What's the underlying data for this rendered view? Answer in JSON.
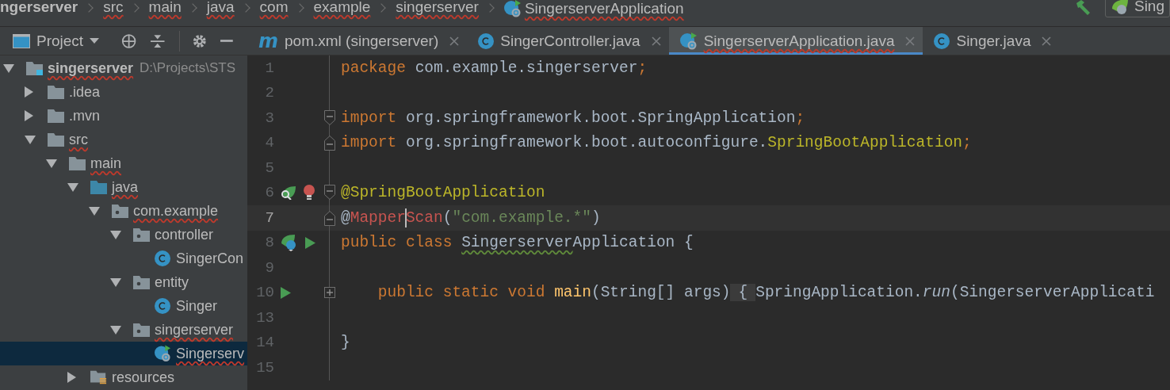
{
  "breadcrumbs": [
    {
      "label": "ngerserver",
      "kind": "project",
      "misspelled": false
    },
    {
      "label": "src",
      "kind": "folder",
      "misspelled": true
    },
    {
      "label": "main",
      "kind": "folder",
      "misspelled": true
    },
    {
      "label": "java",
      "kind": "folder",
      "misspelled": true
    },
    {
      "label": "com",
      "kind": "folder",
      "misspelled": true
    },
    {
      "label": "example",
      "kind": "folder",
      "misspelled": true
    },
    {
      "label": "singerserver",
      "kind": "folder",
      "misspelled": true
    },
    {
      "label": "SingerserverApplication",
      "kind": "app-class",
      "misspelled": true
    }
  ],
  "run_config": {
    "label": "Sing"
  },
  "tool_window": {
    "title": "Project"
  },
  "tabs": [
    {
      "label": "pom.xml (singerserver)",
      "kind": "maven",
      "badge": "m",
      "selected": false,
      "misspelled": false
    },
    {
      "label": "SingerController.java",
      "kind": "class",
      "selected": false,
      "misspelled": false
    },
    {
      "label": "SingerserverApplication.java",
      "kind": "app-class",
      "selected": true,
      "misspelled": true
    },
    {
      "label": "Singer.java",
      "kind": "class",
      "selected": false,
      "misspelled": false
    }
  ],
  "tree": [
    {
      "label": "singerserver",
      "kind": "project",
      "path": "D:\\Projects\\STS",
      "expanded": true,
      "selected": false,
      "misspelled": true,
      "children": [
        {
          "label": ".idea",
          "kind": "folder",
          "expanded": false,
          "selected": false,
          "misspelled": false
        },
        {
          "label": ".mvn",
          "kind": "folder",
          "expanded": false,
          "selected": false,
          "misspelled": false
        },
        {
          "label": "src",
          "kind": "folder",
          "expanded": true,
          "selected": false,
          "misspelled": true,
          "children": [
            {
              "label": "main",
              "kind": "folder",
              "expanded": true,
              "selected": false,
              "misspelled": true,
              "children": [
                {
                  "label": "java",
                  "kind": "source-folder",
                  "expanded": true,
                  "selected": false,
                  "misspelled": true,
                  "children": [
                    {
                      "label": "com.example",
                      "kind": "package",
                      "expanded": true,
                      "selected": false,
                      "misspelled": true,
                      "children": [
                        {
                          "label": "controller",
                          "kind": "package",
                          "expanded": true,
                          "selected": false,
                          "misspelled": false,
                          "children": [
                            {
                              "label": "SingerCon",
                              "kind": "class",
                              "selected": false,
                              "misspelled": false
                            }
                          ]
                        },
                        {
                          "label": "entity",
                          "kind": "package",
                          "expanded": true,
                          "selected": false,
                          "misspelled": false,
                          "children": [
                            {
                              "label": "Singer",
                              "kind": "class",
                              "selected": false,
                              "misspelled": false
                            }
                          ]
                        },
                        {
                          "label": "singerserver",
                          "kind": "package",
                          "expanded": true,
                          "selected": false,
                          "misspelled": true,
                          "children": [
                            {
                              "label": "Singerserv",
                              "kind": "app-class",
                              "selected": true,
                              "misspelled": true
                            }
                          ]
                        }
                      ]
                    }
                  ]
                },
                {
                  "label": "resources",
                  "kind": "resources",
                  "expanded": false,
                  "selected": false,
                  "misspelled": false
                }
              ]
            }
          ]
        }
      ]
    }
  ],
  "editor": {
    "lines": [
      {
        "number": "1",
        "current": false,
        "tokens": [
          {
            "kind": "keyword",
            "text": "package "
          },
          {
            "kind": "plain",
            "text": "com.example.singerserver"
          },
          {
            "kind": "keyword",
            "text": ";"
          }
        ]
      },
      {
        "number": "2",
        "current": false
      },
      {
        "number": "3",
        "current": false,
        "fold": {
          "kind": "start"
        },
        "tokens": [
          {
            "kind": "keyword",
            "text": "import "
          },
          {
            "kind": "plain",
            "text": "org.springframework.boot.SpringApplication"
          },
          {
            "kind": "keyword",
            "text": ";"
          }
        ]
      },
      {
        "number": "4",
        "current": false,
        "fold": {
          "kind": "end"
        },
        "tokens": [
          {
            "kind": "keyword",
            "text": "import "
          },
          {
            "kind": "plain",
            "text": "org.springframework.boot.autoconfigure."
          },
          {
            "kind": "annotation",
            "text": "SpringBootApplication"
          },
          {
            "kind": "keyword",
            "text": ";"
          }
        ]
      },
      {
        "number": "5",
        "current": false
      },
      {
        "number": "6",
        "current": false,
        "fold": {
          "kind": "start"
        },
        "gutter": [
          {
            "kind": "bean-search"
          },
          {
            "kind": "bulb"
          }
        ],
        "tokens": [
          {
            "kind": "annotation",
            "text": "@SpringBootApplication"
          }
        ]
      },
      {
        "number": "7",
        "current": true,
        "fold": {
          "kind": "end"
        },
        "tokens": [
          {
            "kind": "plain",
            "text": "@"
          },
          {
            "kind": "error",
            "text": "Mapper"
          },
          {
            "kind": "caret"
          },
          {
            "kind": "error",
            "text": "Scan"
          },
          {
            "kind": "plain",
            "text": "("
          },
          {
            "kind": "string",
            "text": "\"com.example.*\""
          },
          {
            "kind": "plain",
            "text": ")"
          }
        ]
      },
      {
        "number": "8",
        "current": false,
        "gutter": [
          {
            "kind": "bean"
          },
          {
            "kind": "run"
          }
        ],
        "tokens": [
          {
            "kind": "keyword",
            "text": "public class "
          },
          {
            "kind": "typo",
            "text": "Singerserver"
          },
          {
            "kind": "plain",
            "text": "Application {"
          }
        ]
      },
      {
        "number": "9",
        "current": false
      },
      {
        "number": "10",
        "current": false,
        "fold": {
          "kind": "collapsed"
        },
        "gutter": [
          {
            "kind": "run"
          }
        ],
        "tokens": [
          {
            "kind": "indent"
          },
          {
            "kind": "keyword",
            "text": "public static void "
          },
          {
            "kind": "method",
            "text": "main"
          },
          {
            "kind": "plain",
            "text": "(String[] args)"
          },
          {
            "kind": "folded",
            "text": "{"
          },
          {
            "kind": "plain",
            "text": "SpringApplication."
          },
          {
            "kind": "italic",
            "text": "run"
          },
          {
            "kind": "plain",
            "text": "(SingerserverApplicati"
          }
        ]
      },
      {
        "number": "13",
        "current": false
      },
      {
        "number": "14",
        "current": false,
        "tokens": [
          {
            "kind": "plain",
            "text": "}"
          }
        ]
      },
      {
        "number": "15",
        "current": false
      }
    ]
  }
}
